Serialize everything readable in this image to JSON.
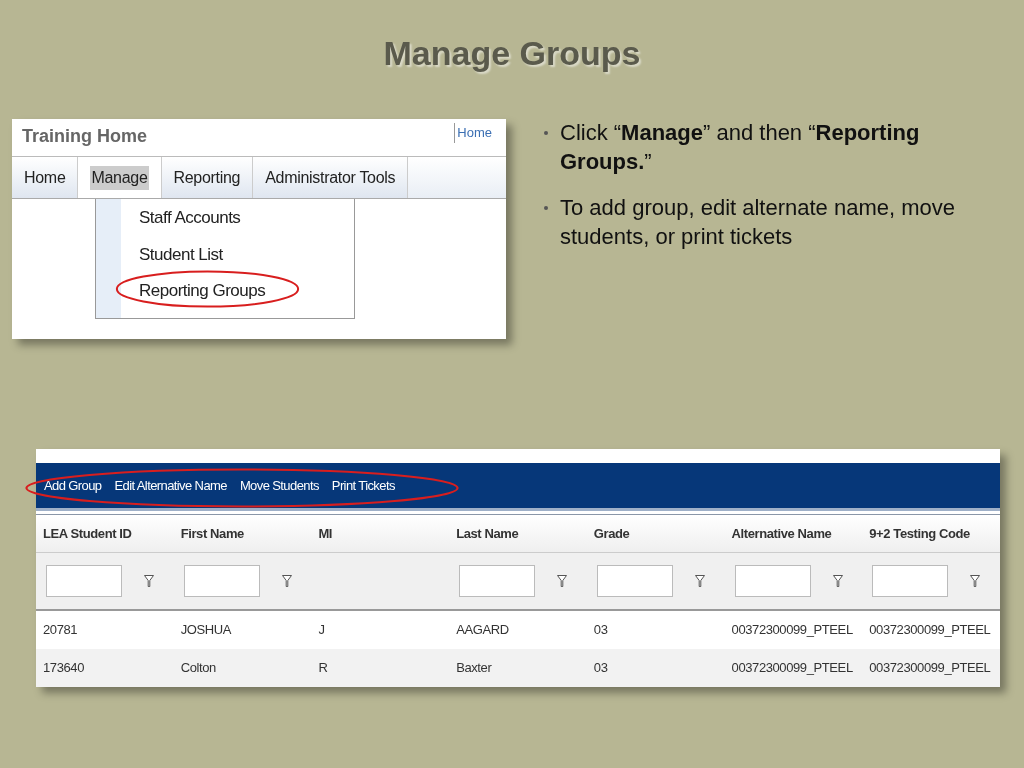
{
  "slide_title": "Manage Groups",
  "menu_screenshot": {
    "title": "Training Home",
    "home_link": "Home",
    "tabs": [
      {
        "label": "Home",
        "selected": false
      },
      {
        "label": "Manage",
        "selected": true
      },
      {
        "label": "Reporting",
        "selected": false
      },
      {
        "label": "Administrator Tools",
        "selected": false
      }
    ],
    "dropdown": [
      {
        "label": "Staff Accounts",
        "circled": false
      },
      {
        "label": "Student List",
        "circled": false
      },
      {
        "label": "Reporting Groups",
        "circled": true
      }
    ]
  },
  "bullets": [
    "Click “**Manage**” and then “**Reporting Groups.**”",
    "To add group, edit alternate name, move students, or print tickets"
  ],
  "groups_screenshot": {
    "toolbar": {
      "circled": true,
      "actions": [
        "Add Group",
        "Edit Alternative Name",
        "Move Students",
        "Print Tickets"
      ]
    },
    "columns": [
      {
        "label": "LEA Student ID",
        "filterable": true
      },
      {
        "label": "First Name",
        "filterable": true
      },
      {
        "label": "MI",
        "filterable": false
      },
      {
        "label": "Last Name",
        "filterable": true
      },
      {
        "label": "Grade",
        "filterable": true
      },
      {
        "label": "Alternative Name",
        "filterable": true
      },
      {
        "label": "9+2 Testing Code",
        "filterable": true
      }
    ],
    "rows": [
      [
        "20781",
        "JOSHUA",
        "J",
        "AAGARD",
        "03",
        "00372300099_PTEEL",
        "00372300099_PTEEL"
      ],
      [
        "173640",
        "Colton",
        "R",
        "Baxter",
        "03",
        "00372300099_PTEEL",
        "00372300099_PTEEL"
      ]
    ]
  }
}
